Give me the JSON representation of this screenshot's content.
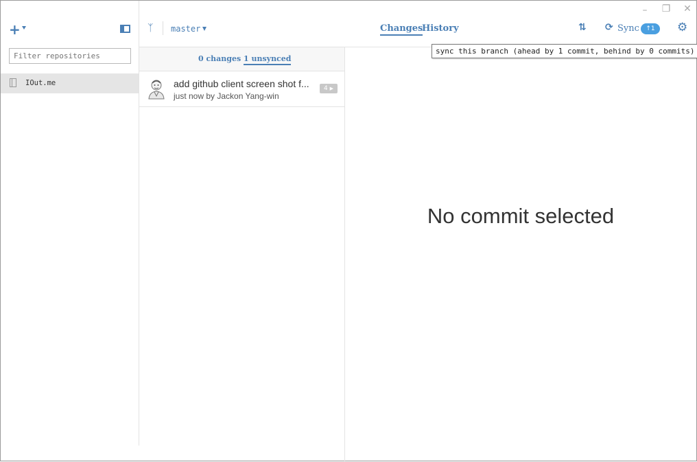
{
  "window": {
    "minimize_icon": "minimize-icon",
    "maximize_icon": "maximize-icon",
    "close_icon": "close-icon"
  },
  "sidebar": {
    "filter_placeholder": "Filter repositories",
    "repositories": [
      {
        "name": "IOut.me",
        "selected": true
      }
    ]
  },
  "toolbar": {
    "branch": "master",
    "tabs": [
      {
        "label": "Changes",
        "active": true
      },
      {
        "label": "History",
        "active": false
      }
    ],
    "sync_label": "Sync",
    "sync_badge": "↑1"
  },
  "tooltip": "sync this branch (ahead by 1 commit, behind by 0 commits)",
  "commit_list": {
    "subtabs": [
      {
        "label": "0 changes",
        "active": false
      },
      {
        "label": "1 unsynced",
        "active": true
      }
    ],
    "commits": [
      {
        "title": "add github client screen shot f...",
        "meta": "just now by Jackon Yang-win",
        "file_count": "4"
      }
    ]
  },
  "detail": {
    "empty_message": "No commit selected"
  },
  "colors": {
    "accent": "#4a7fb5",
    "badge": "#4a9fe0",
    "selected_row": "#e5e5e5"
  }
}
